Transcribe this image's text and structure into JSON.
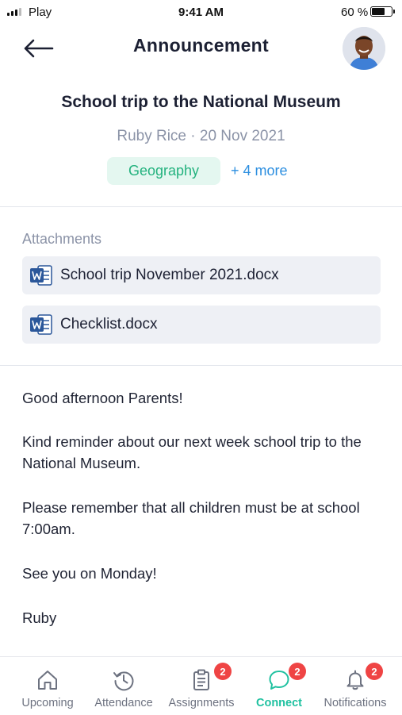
{
  "status_bar": {
    "carrier": "Play",
    "time": "9:41 AM",
    "battery": "60 %"
  },
  "header": {
    "title": "Announcement",
    "back_icon": "arrow-left-icon"
  },
  "announcement": {
    "title": "School trip to the National Museum",
    "meta": "Ruby Rice · 20 Nov 2021",
    "tag": "Geography",
    "more_tags": "+ 4 more"
  },
  "attachments": {
    "label": "Attachments",
    "items": [
      {
        "name": "School trip November 2021.docx",
        "icon": "word-doc-icon"
      },
      {
        "name": "Checklist.docx",
        "icon": "word-doc-icon"
      }
    ]
  },
  "body": [
    "Good afternoon Parents!",
    "Kind reminder about our next week school trip to the National Museum.",
    "Please remember that all children must be at school 7:00am.",
    "See you on Monday!",
    "Ruby"
  ],
  "tabs": [
    {
      "label": "Upcoming",
      "icon": "home-icon",
      "badge": null,
      "active": false
    },
    {
      "label": "Attendance",
      "icon": "history-icon",
      "badge": null,
      "active": false
    },
    {
      "label": "Assignments",
      "icon": "clipboard-icon",
      "badge": "2",
      "active": false
    },
    {
      "label": "Connect",
      "icon": "chat-bubble-icon",
      "badge": "2",
      "active": true
    },
    {
      "label": "Notifications",
      "icon": "bell-icon",
      "badge": "2",
      "active": false
    }
  ],
  "colors": {
    "accent": "#1fc1a0",
    "link": "#2d8fe0",
    "badge": "#ef4444",
    "tag_bg": "#e4f7f0",
    "tag_text": "#23b27e"
  }
}
